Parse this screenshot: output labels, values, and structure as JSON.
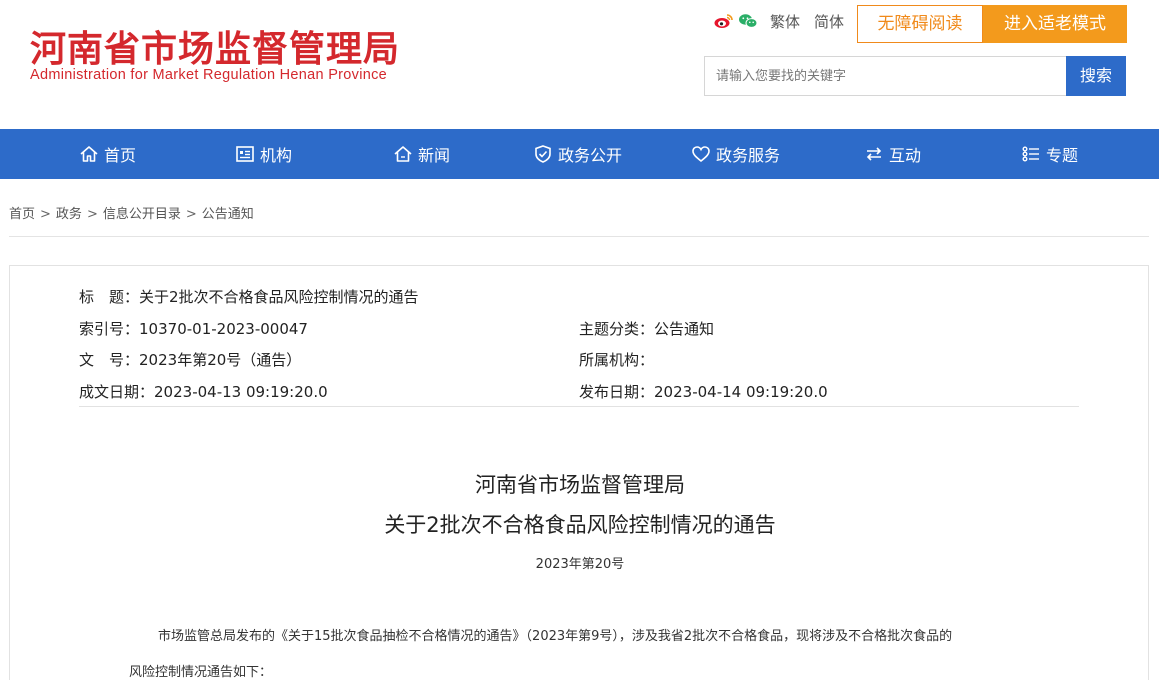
{
  "header": {
    "logo_cn": "河南省市场监督管理局",
    "logo_en": "Administration for Market Regulation Henan Province",
    "brand_color": "#d4282d",
    "weibo_icon": "weibo-icon",
    "wechat_icon": "wechat-icon",
    "lang_traditional": "繁体",
    "lang_simplified": "简体",
    "accessible_label": "无障碍阅读",
    "elder_mode_label": "进入适老模式",
    "search_placeholder": "请输入您要找的关键字",
    "search_label": "搜索"
  },
  "nav": {
    "color": "#2d6bc9",
    "items": [
      {
        "label": "首页",
        "icon": "home-icon"
      },
      {
        "label": "机构",
        "icon": "org-icon"
      },
      {
        "label": "新闻",
        "icon": "news-icon"
      },
      {
        "label": "政务公开",
        "icon": "shield-icon"
      },
      {
        "label": "政务服务",
        "icon": "heart-icon"
      },
      {
        "label": "互动",
        "icon": "exchange-icon"
      },
      {
        "label": "专题",
        "icon": "list-icon"
      }
    ]
  },
  "breadcrumb": {
    "items": [
      "首页",
      "政务",
      "信息公开目录",
      "公告通知"
    ],
    "separator": ">"
  },
  "meta": {
    "title_label": "标　题：",
    "title_value": "关于2批次不合格食品风险控制情况的通告",
    "index_label": "索引号：",
    "index_value": "10370-01-2023-00047",
    "topic_label": "主题分类：",
    "topic_value": "公告通知",
    "docno_label": "文　号：",
    "docno_value": "2023年第20号（通告）",
    "org_label": "所属机构：",
    "org_value": "",
    "created_label": "成文日期：",
    "created_value": "2023-04-13 09:19:20.0",
    "published_label": "发布日期：",
    "published_value": "2023-04-14 09:19:20.0"
  },
  "article": {
    "title_line1": "河南省市场监督管理局",
    "title_line2": "关于2批次不合格食品风险控制情况的通告",
    "doc_number": "2023年第20号",
    "para1": "市场监管总局发布的《关于15批次食品抽检不合格情况的通告》（2023年第9号），涉及我省2批次不合格食品，现将涉及不合格批次食品的",
    "para2": "风险控制情况通告如下："
  }
}
